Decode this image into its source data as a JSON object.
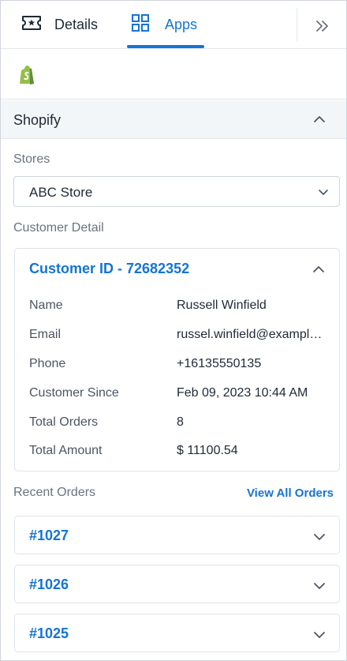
{
  "tabs": [
    {
      "label": "Details",
      "icon": "ticket-icon",
      "active": false
    },
    {
      "label": "Apps",
      "icon": "grid-icon",
      "active": true
    }
  ],
  "colors": {
    "accent": "#1474d4",
    "shopify_green": "#95bf47",
    "header_bg": "#f3f6f9",
    "muted": "#6b7280"
  },
  "app": {
    "logo": "shopify-logo-icon"
  },
  "section": {
    "title": "Shopify"
  },
  "stores": {
    "label": "Stores",
    "selected": "ABC Store"
  },
  "customer": {
    "section_label": "Customer Detail",
    "title": "Customer ID - 72682352",
    "fields": [
      {
        "key": "Name",
        "value": "Russell Winfield"
      },
      {
        "key": "Email",
        "value": "russel.winfield@example.com"
      },
      {
        "key": "Phone",
        "value": "+16135550135"
      },
      {
        "key": "Customer Since",
        "value": "Feb 09, 2023 10:44 AM"
      },
      {
        "key": "Total Orders",
        "value": "8"
      },
      {
        "key": "Total Amount",
        "value": "$ 11100.54"
      }
    ]
  },
  "recent_orders": {
    "label": "Recent Orders",
    "view_all": "View All Orders",
    "orders": [
      {
        "id": "#1027"
      },
      {
        "id": "#1026"
      },
      {
        "id": "#1025"
      }
    ]
  }
}
